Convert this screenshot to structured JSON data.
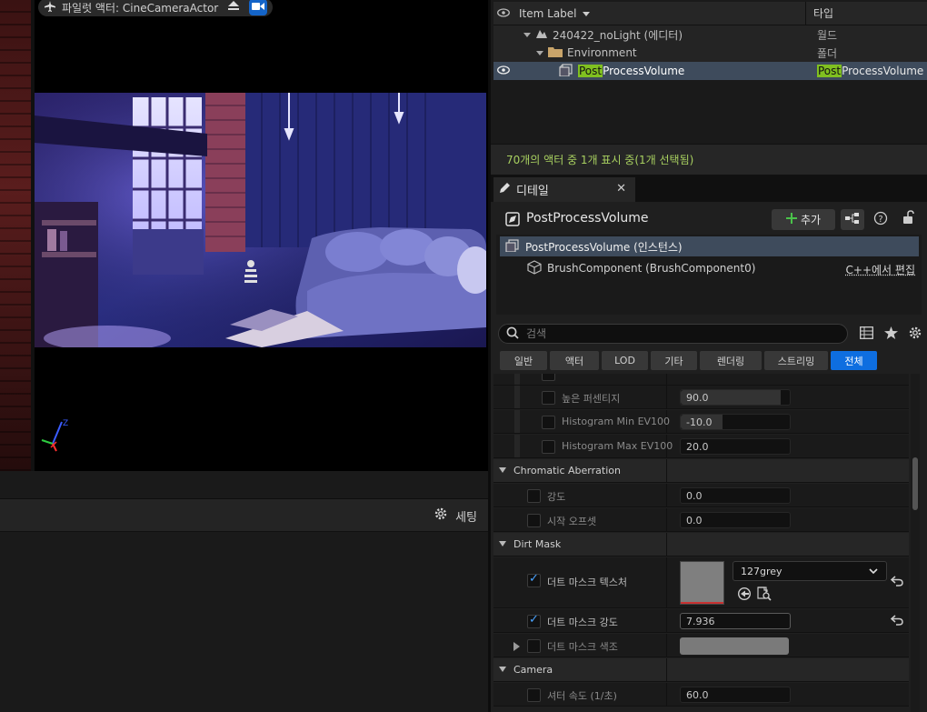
{
  "viewport": {
    "pilot_label": "파일럿 액터: CineCameraActor"
  },
  "lower_panel": {
    "settings_label": "세팅"
  },
  "outliner": {
    "header_label": "Item Label",
    "header_type": "타입",
    "rows": [
      {
        "label": "240422_noLight (에디터)",
        "type": "월드"
      },
      {
        "label": "Environment",
        "type": "폴더"
      },
      {
        "label_highlight": "Post",
        "label_rest": "ProcessVolume",
        "type_highlight": "Post",
        "type_rest": "ProcessVolume"
      }
    ],
    "status": "70개의 액터 중 1개 표시 중(1개 선택됨)"
  },
  "details": {
    "tab_label": "디테일",
    "title": "PostProcessVolume",
    "add_label": "추가",
    "components": {
      "root": "PostProcessVolume (인스턴스)",
      "child": "BrushComponent (BrushComponent0)",
      "cpp_edit": "C++에서 편집"
    },
    "search_placeholder": "검색",
    "filters": [
      "일반",
      "액터",
      "LOD",
      "기타",
      "렌더링",
      "스트리밍",
      "전체"
    ],
    "active_filter": "전체",
    "properties": {
      "high_percentage": {
        "label": "높은 퍼센티지",
        "value": "90.0"
      },
      "hist_min": {
        "label": "Histogram Min EV100",
        "value": "-10.0"
      },
      "hist_max": {
        "label": "Histogram Max EV100",
        "value": "20.0"
      },
      "cat_chromatic": "Chromatic Aberration",
      "ca_intensity": {
        "label": "강도",
        "value": "0.0"
      },
      "ca_start_offset": {
        "label": "시작 오프셋",
        "value": "0.0"
      },
      "cat_dirt": "Dirt Mask",
      "dirt_texture": {
        "label": "더트 마스크 텍스처",
        "value": "127grey",
        "enabled": true
      },
      "dirt_intensity": {
        "label": "더트 마스크 강도",
        "value": "7.936",
        "enabled": true
      },
      "dirt_tint": {
        "label": "더트 마스크 색조"
      },
      "cat_camera": "Camera",
      "shutter_speed": {
        "label": "셔터 속도 (1/초)",
        "value": "60.0"
      }
    }
  },
  "colors": {
    "selection": "#3e4b5c",
    "accent_blue": "#0e6ee0",
    "highlight_green": "#80c020",
    "status_green": "#a8d060"
  }
}
